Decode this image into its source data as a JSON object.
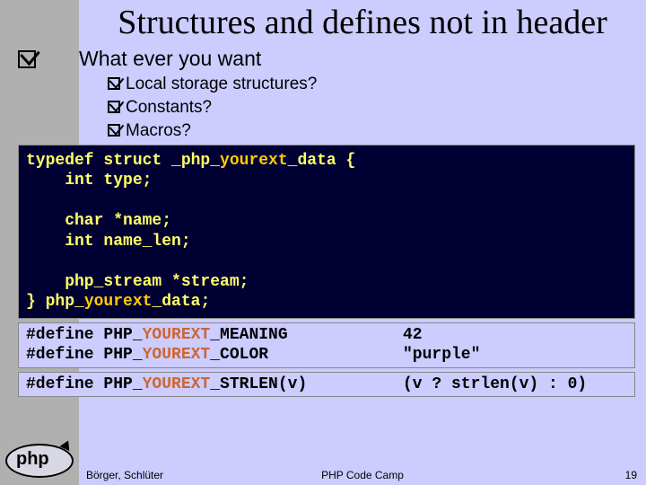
{
  "title": "Structures and defines not in header",
  "main_bullet": "What ever you want",
  "sub_bullets": [
    "Local storage structures?",
    "Constants?",
    "Macros?"
  ],
  "code": {
    "l1a": "typedef struct _php_",
    "l1b": "yourext",
    "l1c": "_data {",
    "l2": "    int type;",
    "l3": "",
    "l4": "    char *name;",
    "l5": "    int name_len;",
    "l6": "",
    "l7": "    php_stream *stream;",
    "l8a": "} php_",
    "l8b": "yourext",
    "l8c": "_data;"
  },
  "defs": [
    {
      "pre": "#define PHP_",
      "hl": "YOUREXT",
      "post": "_MEANING",
      "val": "42"
    },
    {
      "pre": "#define PHP_",
      "hl": "YOUREXT",
      "post": "_COLOR",
      "val": "\"purple\""
    }
  ],
  "defs2": [
    {
      "pre": "#define PHP_",
      "hl": "YOUREXT",
      "post": "_STRLEN(v)",
      "val": "(v ? strlen(v) : 0)"
    }
  ],
  "footer": {
    "left": "Börger, Schlüter",
    "center": "PHP Code Camp",
    "right": "19"
  },
  "logo_text": "php"
}
